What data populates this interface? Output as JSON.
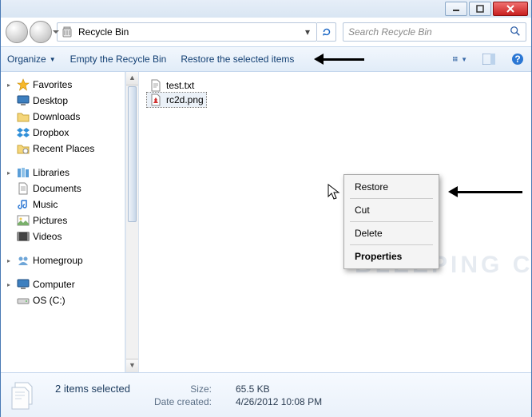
{
  "titlebar": {
    "minimize": "–",
    "maximize": "▢",
    "close": "✕"
  },
  "nav": {
    "breadcrumb": "Recycle Bin",
    "search_placeholder": "Search Recycle Bin"
  },
  "toolbar": {
    "organize": "Organize",
    "empty": "Empty the Recycle Bin",
    "restore": "Restore the selected items"
  },
  "sidebar": {
    "favorites": {
      "label": "Favorites",
      "items": [
        "Desktop",
        "Downloads",
        "Dropbox",
        "Recent Places"
      ]
    },
    "libraries": {
      "label": "Libraries",
      "items": [
        "Documents",
        "Music",
        "Pictures",
        "Videos"
      ]
    },
    "homegroup": {
      "label": "Homegroup"
    },
    "computer": {
      "label": "Computer",
      "items": [
        "OS (C:)"
      ]
    }
  },
  "files": [
    {
      "name": "test.txt"
    },
    {
      "name": "rc2d.png"
    }
  ],
  "context_menu": {
    "restore": "Restore",
    "cut": "Cut",
    "delete": "Delete",
    "properties": "Properties"
  },
  "status": {
    "selected": "2 items selected",
    "size_label": "Size:",
    "size_value": "65.5 KB",
    "date_label": "Date created:",
    "date_value": "4/26/2012 10:08 PM"
  },
  "watermark": "Bleeping Computer",
  "icons": {
    "recycle": "recycle-bin-icon",
    "search": "search-icon"
  }
}
